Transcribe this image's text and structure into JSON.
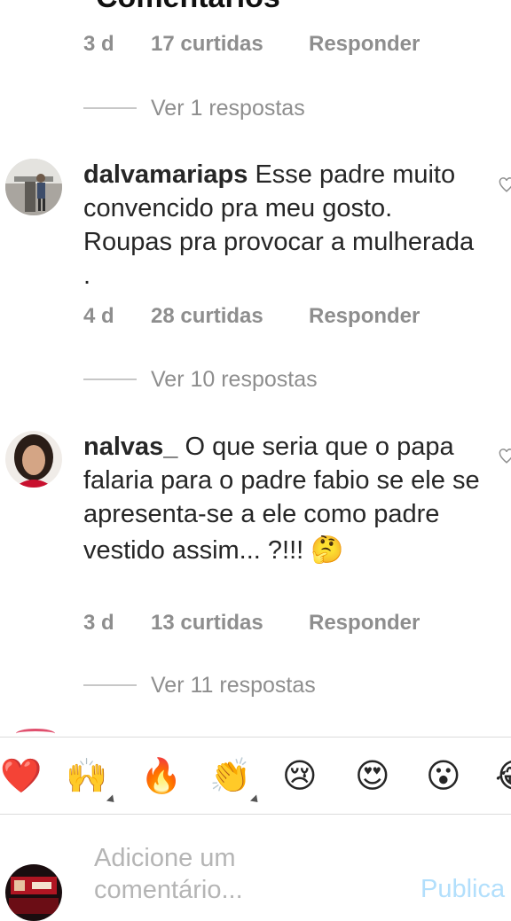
{
  "header": {
    "title": "Comentários"
  },
  "thread": [
    {
      "meta_time": "3 d",
      "meta_likes": "17 curtidas",
      "meta_reply": "Responder",
      "view_replies": "Ver 1 respostas"
    },
    {
      "username": "dalvamariaps",
      "text": " Esse padre muito convencido pra meu gosto. Roupas pra provocar a mulherada .",
      "meta_time": "4 d",
      "meta_likes": "28 curtidas",
      "meta_reply": "Responder",
      "view_replies": "Ver 10 respostas"
    },
    {
      "username": "nalvas_",
      "text": " O que seria que o papa falaria para o padre fabio se ele se apresenta-se a ele como padre  vestido assim... ?!!! ",
      "emoji": "🤔",
      "meta_time": "3 d",
      "meta_likes": "13 curtidas",
      "meta_reply": "Responder",
      "view_replies": "Ver 11 respostas"
    }
  ],
  "reactions": [
    "❤️",
    "🙌",
    "🔥",
    "👏",
    "😢",
    "😍",
    "😮",
    "😂"
  ],
  "composer": {
    "placeholder_line1": "Adicione um",
    "placeholder_line2": "comentário...",
    "publish_label": "Publica"
  },
  "colors": {
    "muted": "#8e8e8e",
    "text": "#262626",
    "publish_disabled": "#b2dffc"
  }
}
